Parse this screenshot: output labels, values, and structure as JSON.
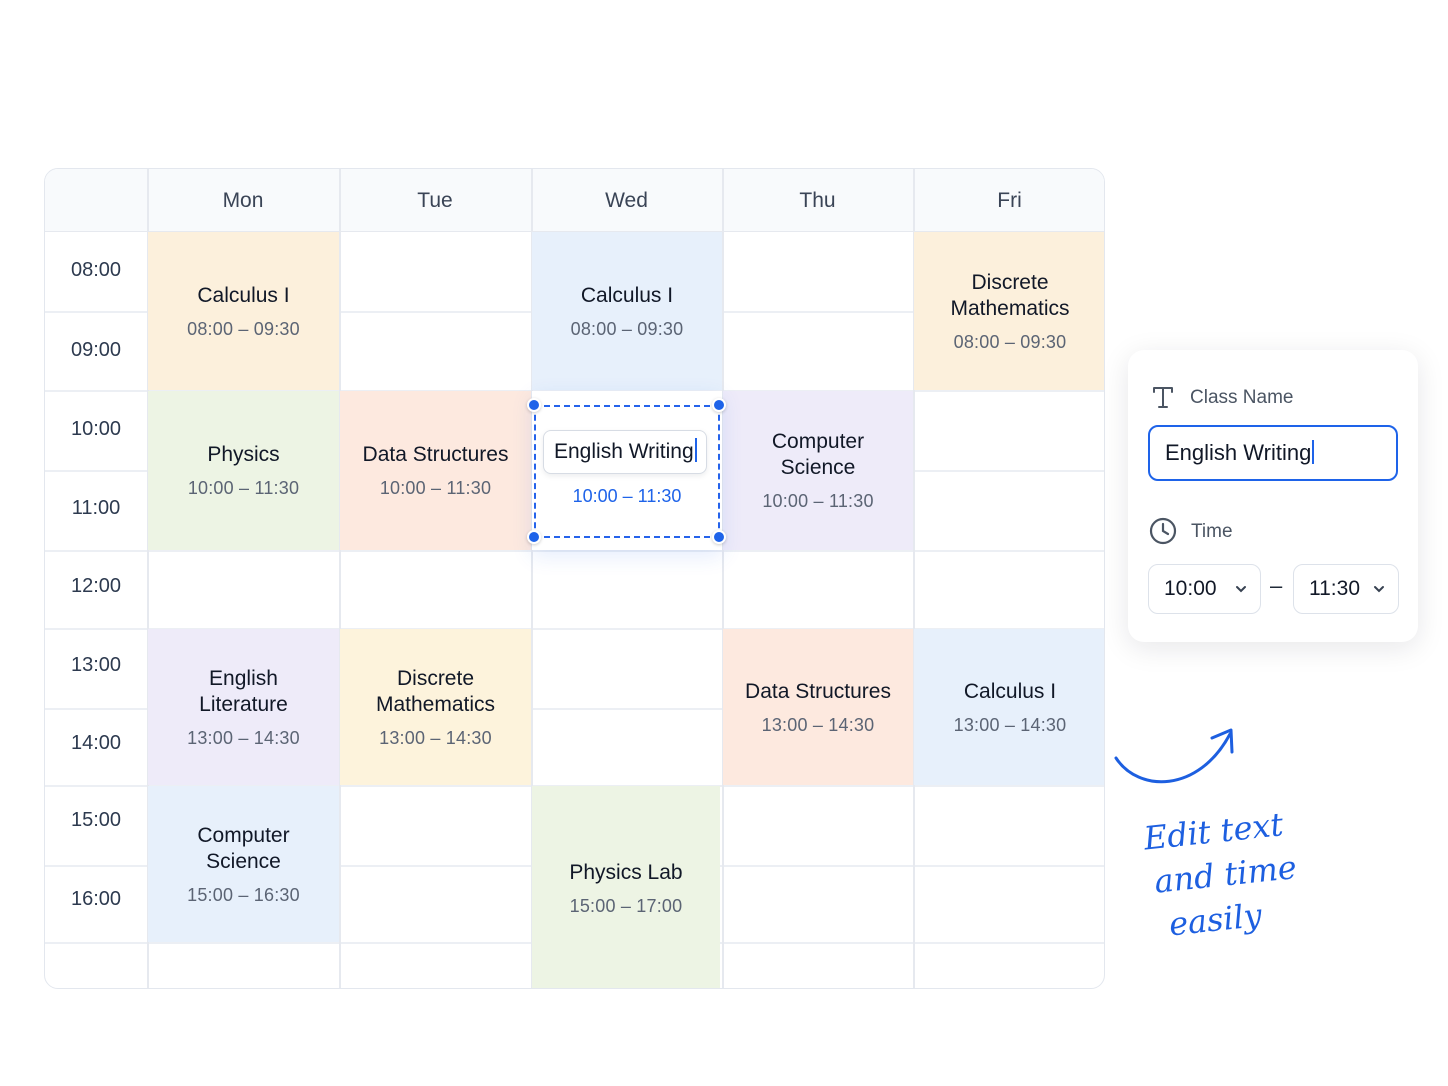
{
  "timetable": {
    "days": [
      "Mon",
      "Tue",
      "Wed",
      "Thu",
      "Fri"
    ],
    "times": [
      "08:00",
      "09:00",
      "10:00",
      "11:00",
      "12:00",
      "13:00",
      "14:00",
      "15:00",
      "16:00"
    ],
    "events": [
      {
        "day": "Mon",
        "title": "Calculus I",
        "time": "08:00 – 09:30",
        "color": "#fcf0dc"
      },
      {
        "day": "Wed",
        "title": "Calculus I",
        "time": "08:00 – 09:30",
        "color": "#e7f0fb"
      },
      {
        "day": "Fri",
        "title": "Discrete Mathematics",
        "time": "08:00 – 09:30",
        "color": "#fcf0dc"
      },
      {
        "day": "Mon",
        "title": "Physics",
        "time": "10:00 – 11:30",
        "color": "#edf4e4"
      },
      {
        "day": "Tue",
        "title": "Data Structures",
        "time": "10:00 – 11:30",
        "color": "#fde9df"
      },
      {
        "day": "Thu",
        "title": "Computer Science",
        "time": "10:00 – 11:30",
        "color": "#eeebf9"
      },
      {
        "day": "Mon",
        "title": "English Literature",
        "time": "13:00 – 14:30",
        "color": "#eeebf9"
      },
      {
        "day": "Tue",
        "title": "Discrete Mathematics",
        "time": "13:00 – 14:30",
        "color": "#fdf3dc"
      },
      {
        "day": "Thu",
        "title": "Data Structures",
        "time": "13:00 – 14:30",
        "color": "#fde9df"
      },
      {
        "day": "Fri",
        "title": "Calculus I",
        "time": "13:00 – 14:30",
        "color": "#e7f0fb"
      },
      {
        "day": "Mon",
        "title": "Computer Science",
        "time": "15:00 – 16:30",
        "color": "#e7f0fb"
      },
      {
        "day": "Wed",
        "title": "Physics Lab",
        "time": "15:00 – 17:00",
        "color": "#edf4e4"
      }
    ],
    "selected_event": {
      "day": "Wed",
      "title": "English Writing",
      "time": "10:00 – 11:30",
      "accent": "#1e63e9"
    }
  },
  "edit_panel": {
    "name_label": "Class Name",
    "name_value": "English Writing",
    "time_label": "Time",
    "start_time": "10:00",
    "end_time": "11:30",
    "separator": "–",
    "accent": "#1e63e9"
  },
  "annotation": {
    "lines": [
      "Edit text",
      "and time",
      "easily"
    ],
    "color": "#1d5fe0"
  }
}
